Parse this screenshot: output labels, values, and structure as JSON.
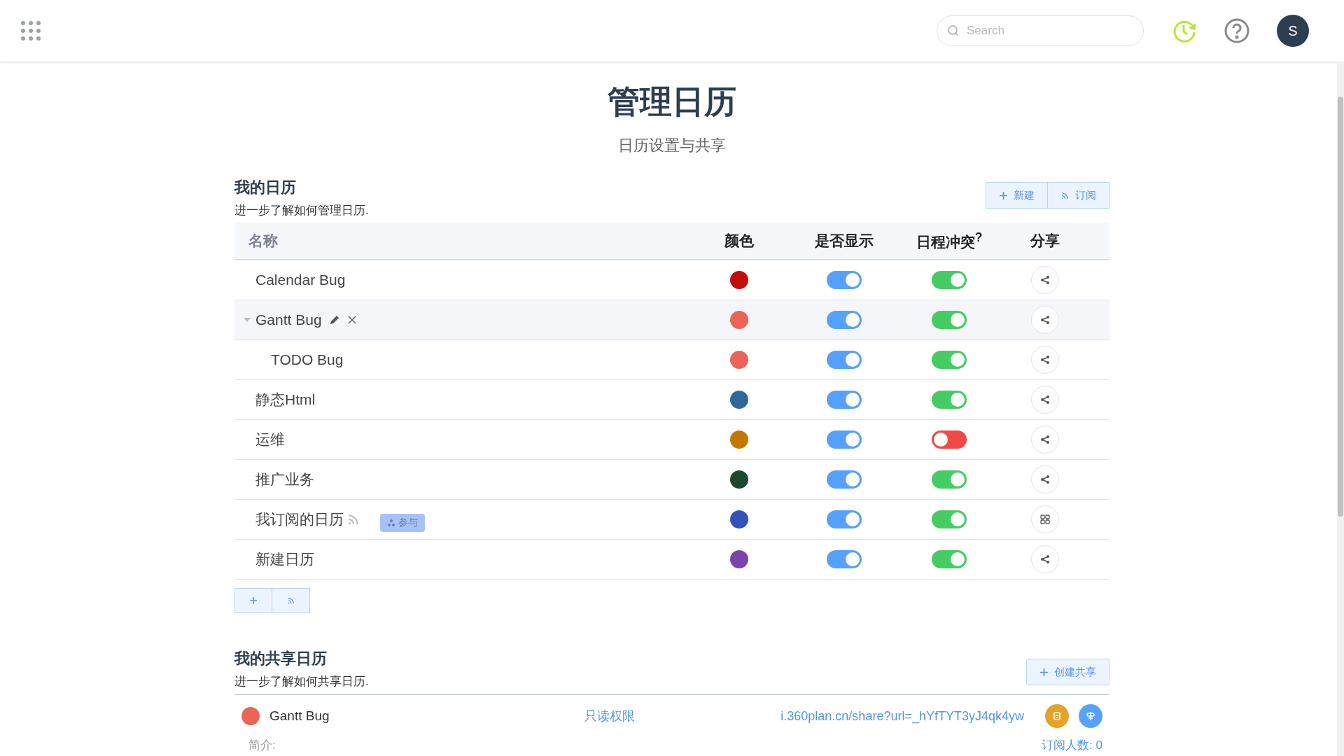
{
  "search": {
    "placeholder": "Search"
  },
  "user": {
    "initial": "S"
  },
  "page": {
    "title": "管理日历",
    "subtitle": "日历设置与共享"
  },
  "my_calendars": {
    "title": "我的日历",
    "help": "进一步了解如何管理日历.",
    "buttons": [
      "新建",
      "订阅"
    ],
    "columns": [
      "名称",
      "颜色",
      "是否显示",
      "日程冲突$^{?}$",
      "分享"
    ],
    "rows": [
      {
        "name": "Calendar Bug",
        "color": "#c40c0c",
        "shown": true,
        "conflict": true,
        "kind": "share",
        "selected": false
      },
      {
        "name": "Gantt Bug",
        "color": "#ea6557",
        "shown": true,
        "conflict": true,
        "kind": "share",
        "selected": true,
        "expanded": true,
        "children": [
          {
            "name": "TODO Bug",
            "color": "#ea6557",
            "shown": true,
            "conflict": true,
            "kind": "share",
            "selected": false
          }
        ]
      },
      {
        "name": "静态Html",
        "color": "#2c6a9c",
        "shown": true,
        "conflict": true,
        "kind": "share",
        "selected": false
      },
      {
        "name": "运维",
        "color": "#c47602",
        "shown": true,
        "conflict": false,
        "kind": "share",
        "selected": false
      },
      {
        "name": "推广业务",
        "color": "#1d4a2e",
        "shown": true,
        "conflict": true,
        "kind": "share",
        "selected": false
      },
      {
        "name": "我订阅的日历",
        "color": "#3352ba",
        "shown": true,
        "conflict": true,
        "kind": "grid",
        "selected": false,
        "subscribed": true,
        "badge": "参与"
      },
      {
        "name": "新建日历",
        "color": "#7a44ab",
        "shown": true,
        "conflict": true,
        "kind": "share",
        "selected": false
      }
    ]
  },
  "shared_calendars": {
    "title": "我的共享日历",
    "help": "进一步了解如何共享日历.",
    "button": "创建共享",
    "items": [
      {
        "name": "Gantt Bug",
        "color": "#ea6557",
        "permission": "只读权限",
        "url": "i.360plan.cn/share?url=_hYfTYT3yJ4qk4yw",
        "intro_label": "简介:",
        "subscribers_label": "订阅人数:",
        "subscribers": "0"
      }
    ]
  }
}
